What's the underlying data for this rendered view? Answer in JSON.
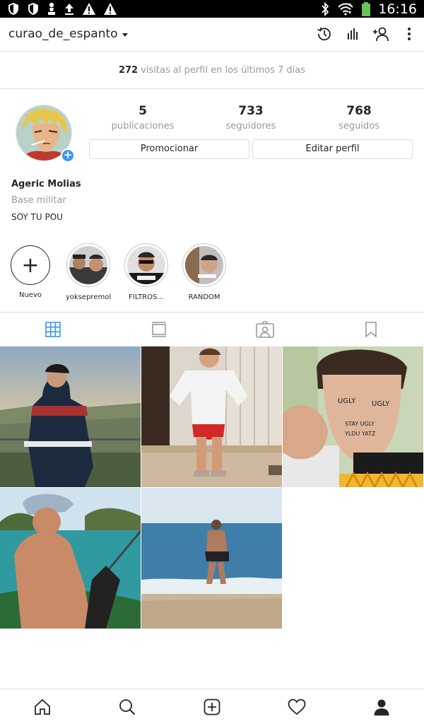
{
  "status_bar": {
    "time": "16:16",
    "left_icons": [
      "shield-icon",
      "shield-icon",
      "pawn-icon",
      "upload-icon",
      "warning-icon",
      "warning-icon"
    ],
    "right_icons": [
      "bluetooth-icon",
      "wifi-icon",
      "battery-icon"
    ]
  },
  "header": {
    "username": "curao_de_espanto",
    "icons": [
      "history-icon",
      "insights-icon",
      "add-person-icon",
      "more-icon"
    ]
  },
  "visits": {
    "count": "272",
    "text": " visitas al perfil en los últimos 7 días"
  },
  "profile": {
    "stats": [
      {
        "value": "5",
        "label": "publicaciones"
      },
      {
        "value": "733",
        "label": "seguidores"
      },
      {
        "value": "768",
        "label": "seguidos"
      }
    ],
    "buttons": {
      "promote": "Promocionar",
      "edit": "Editar perfil"
    },
    "name": "Ageric Molias",
    "category": "Base militar",
    "bio": "SOY TU POU"
  },
  "highlights": [
    {
      "label": "Nuevo"
    },
    {
      "label": "yoksepremol"
    },
    {
      "label": "FILTROS..."
    },
    {
      "label": "RANDOM"
    }
  ],
  "tabs": [
    "grid-icon",
    "feed-icon",
    "tagged-icon",
    "saved-icon"
  ],
  "bottom_nav": [
    "home-icon",
    "search-icon",
    "add-post-icon",
    "heart-icon",
    "profile-icon"
  ],
  "colors": {
    "accent": "#3897f0",
    "text": "#262626",
    "muted": "#999999",
    "border": "#dbdbdb"
  }
}
